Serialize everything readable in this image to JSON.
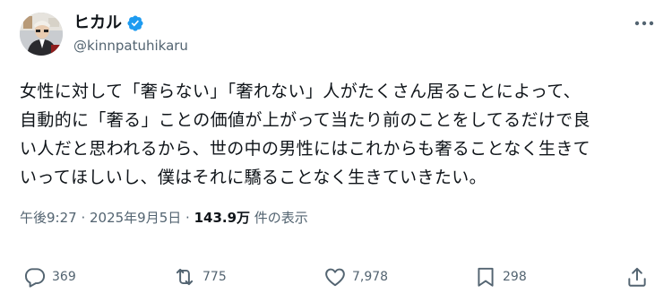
{
  "author": {
    "display_name": "ヒカル",
    "handle": "@kinnpatuhikaru",
    "verified_color": "#1d9bf0"
  },
  "post": {
    "lines": [
      "女性に対して「奢らない」「奢れない」人がたくさん居ることによって、",
      "自動的に「奢る」ことの価値が上がって当たり前のことをしてるだけで良",
      "い人だと思われるから、世の中の男性にはこれからも奢ることなく生きて",
      "いってほしいし、僕はそれに驕ることなく生きていきたい。"
    ]
  },
  "meta": {
    "time": "午後9:27",
    "separator1": " · ",
    "date": "2025年9月5日",
    "separator2": " · ",
    "views_count": "143.9万",
    "views_label": " 件の表示"
  },
  "actions": {
    "replies": "369",
    "reposts": "775",
    "likes": "7,978",
    "bookmarks": "298"
  },
  "icons": {
    "more": "more-icon",
    "reply": "reply-icon",
    "repost": "repost-icon",
    "like": "heart-icon",
    "bookmark": "bookmark-icon",
    "share": "share-icon"
  },
  "colors": {
    "text": "#0f1419",
    "secondary": "#536471",
    "accent": "#1d9bf0"
  }
}
